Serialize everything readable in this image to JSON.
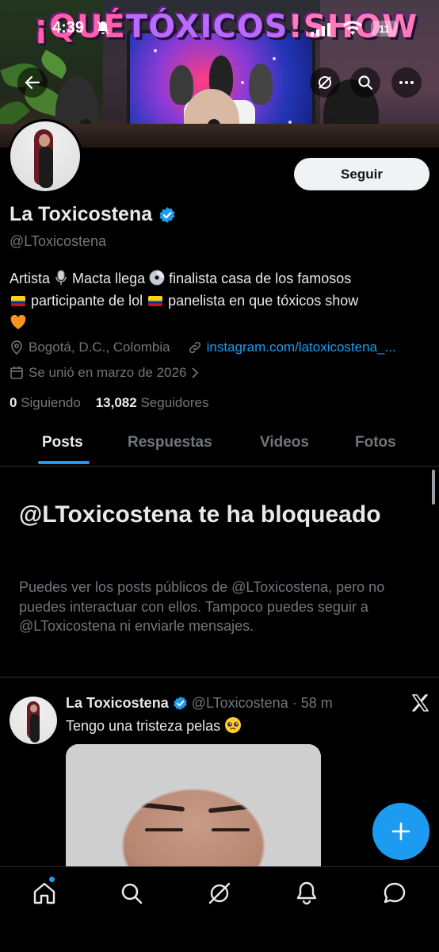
{
  "status_bar": {
    "time": "4:39",
    "battery": "11"
  },
  "banner": {
    "title_part1": "¡QUÉ ",
    "title_part2": "TÓXICOS",
    "title_part3": "!SHOW",
    "screen_text": "¡QUÉ TÓXICOS!"
  },
  "profile": {
    "follow_label": "Seguir",
    "display_name": "La Toxicostena",
    "handle": "@LToxicostena",
    "bio": {
      "part1": "Artista",
      "part2": " Macta llega ",
      "part3": " finalista casa de los famosos",
      "part4": " participante de lol ",
      "part5": " panelista en que tóxicos show"
    },
    "location": "Bogotá, D.C., Colombia",
    "link": "instagram.com/latoxicostena_...",
    "joined": "Se unió en marzo de 2026",
    "following_count": "0",
    "following_label": " Siguiendo",
    "followers_count": "13,082",
    "followers_label": " Seguidores"
  },
  "tabs": [
    {
      "label": "Posts",
      "active": true
    },
    {
      "label": "Respuestas",
      "active": false
    },
    {
      "label": "Videos",
      "active": false
    },
    {
      "label": "Fotos",
      "active": false
    }
  ],
  "blocked": {
    "title": "@LToxicostena te ha bloqueado",
    "description": "Puedes ver los posts públicos de @LToxicostena, pero no puedes interactuar con ellos. Tampoco puedes seguir a @LToxicostena ni enviarle mensajes."
  },
  "tweet": {
    "name": "La Toxicostena",
    "handle": "@LToxicostena",
    "separator": "·",
    "time": "58 m",
    "text": "Tengo una tristeza pelas"
  },
  "colors": {
    "accent": "#1d9bf0",
    "background": "#000000",
    "text_primary": "#e7e9ea",
    "text_secondary": "#71767b"
  },
  "icons": {
    "back": "arrow-left-icon",
    "grok": "grok-icon",
    "search": "search-icon",
    "more": "more-icon",
    "verified": "verified-badge-icon",
    "location": "location-pin-icon",
    "link": "link-icon",
    "calendar": "calendar-icon",
    "x": "x-logo-icon",
    "compose": "plus-icon",
    "home": "home-icon",
    "notifications": "bell-icon",
    "messages": "chat-bubble-icon"
  }
}
